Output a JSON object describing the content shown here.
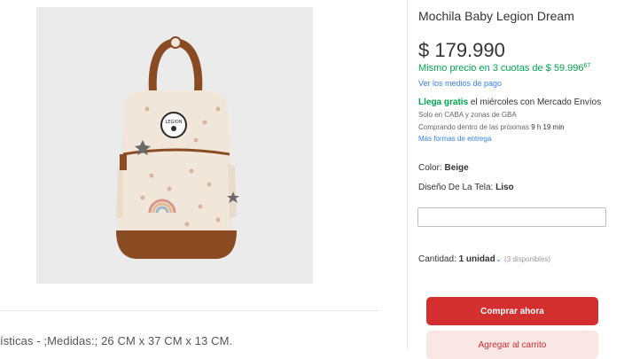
{
  "product": {
    "title": "Mochila Baby Legion Dream",
    "price": "$ 179.990",
    "installments_text": "Mismo precio en 3 cuotas de $ 59.996",
    "installments_cents": "67",
    "payment_methods_link": "Ver los medios de pago",
    "image_alt": "Mochila beige con detalles marrones",
    "description_line": "ísticas - ;Medidas:; 26 CM x 37 CM x 13 CM."
  },
  "shipping": {
    "free_label": "Llega gratis",
    "arrival_text": "el miércoles con Mercado Envíos",
    "zone_text": "Solo en CABA y zonas de GBA",
    "timer_prefix": "Comprando dentro de las próximas",
    "timer_value": "9 h 19 min",
    "more_link": "Más formas de entrega"
  },
  "attributes": {
    "color_label": "Color:",
    "color_value": "Beige",
    "design_label": "Diseño De La Tela:",
    "design_value": "Liso"
  },
  "quantity": {
    "label": "Cantidad:",
    "value": "1 unidad",
    "available": "(3 disponibles)"
  },
  "actions": {
    "buy_now": "Comprar ahora",
    "add_to_cart": "Agregar al carrito"
  },
  "colors": {
    "accent_red": "#d32f2f",
    "green": "#00a650",
    "link_blue": "#3483fa"
  }
}
